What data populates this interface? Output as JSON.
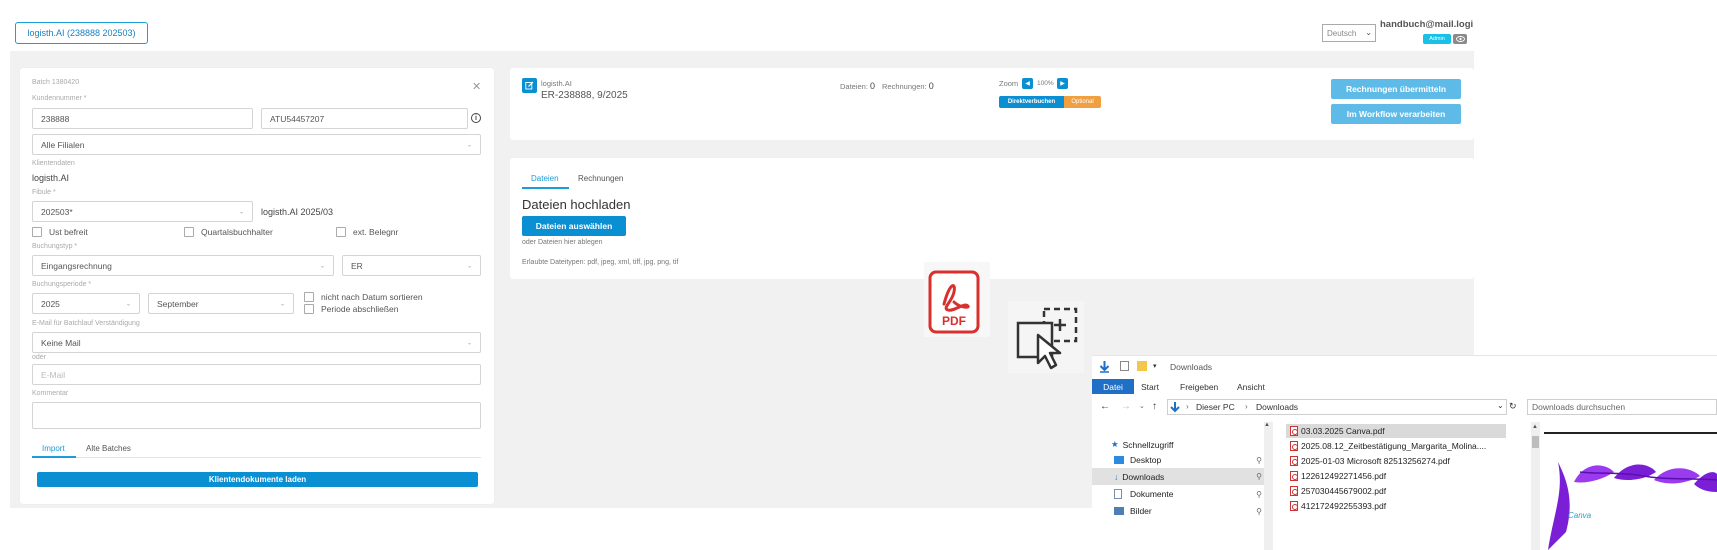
{
  "header": {
    "client_button": "logisth.AI (238888 202503)",
    "language": "Deutsch",
    "user_email": "handbuch@mail.logi",
    "admin_badge": "Admin",
    "colors": {
      "accent": "#0a8fd2",
      "badge": "#17c1e8",
      "optional": "#f0a040"
    }
  },
  "left": {
    "batch_label": "Batch 1380420",
    "kundennummer_label": "Kundennummer *",
    "kundennummer_value": "238888",
    "ust_value": "ATU54457207",
    "filialen_value": "Alle Filialen",
    "klientendaten_label": "Klientendaten",
    "klientendaten_value": "logisth.AI",
    "fibule_label": "Fibule *",
    "fibule_value": "202503*",
    "fibule_text": "logisth.AI 2025/03",
    "cb_ust": "Ust befreit",
    "cb_quartal": "Quartalsbuchhalter",
    "cb_ext": "ext. Belegnr",
    "buchungstyp_label": "Buchungstyp *",
    "buchungstyp_value": "Eingangsrechnung",
    "buchungstyp_code": "ER",
    "periode_label": "Buchungsperiode *",
    "year_value": "2025",
    "month_value": "September",
    "cb_sort": "nicht nach Datum sortieren",
    "cb_close": "Periode abschließen",
    "email_label": "E-Mail für Batchlauf Verständigung",
    "email_select": "Keine Mail",
    "oder": "oder",
    "email_placeholder": "E-Mail",
    "kommentar_label": "Kommentar",
    "tab_import": "Import",
    "tab_alte": "Alte Batches",
    "load_button": "Klientendokumente laden"
  },
  "top_card": {
    "client_name": "logisth.AI",
    "batch_ref": "ER-238888, 9/2025",
    "dateien_label": "Dateien:",
    "dateien_count": "0",
    "rechnungen_label": "Rechnungen:",
    "rechnungen_count": "0",
    "zoom_label": "Zoom",
    "zoom_value": "100%",
    "direkt_label": "Direktverbuchen",
    "optional_label": "Optional",
    "submit_button": "Rechnungen übermitteln",
    "workflow_button": "Im Workflow verarbeiten"
  },
  "upload_card": {
    "tab_dateien": "Dateien",
    "tab_rechnungen": "Rechnungen",
    "title": "Dateien hochladen",
    "choose_button": "Dateien auswählen",
    "drop_hint": "oder Dateien hier ablegen",
    "allowed_types": "Erlaubte Dateitypen: pdf, jpeg, xml, tiff, jpg, png, tif"
  },
  "explorer": {
    "title": "Downloads",
    "ribbon": [
      "Datei",
      "Start",
      "Freigeben",
      "Ansicht"
    ],
    "path": [
      "Dieser PC",
      "Downloads"
    ],
    "search_placeholder": "Downloads durchsuchen",
    "nav": [
      "Schnellzugriff",
      "Desktop",
      "Downloads",
      "Dokumente",
      "Bilder"
    ],
    "files": [
      "03.03.2025 Canva.pdf",
      "2025.08.12_Zeitbestätigung_Margarita_Molina....",
      "2025-01-03 Microsoft 82513256274.pdf",
      "122612492271456.pdf",
      "257030445679002.pdf",
      "412172492255393.pdf"
    ],
    "pdf_icon_text": "PDF"
  }
}
